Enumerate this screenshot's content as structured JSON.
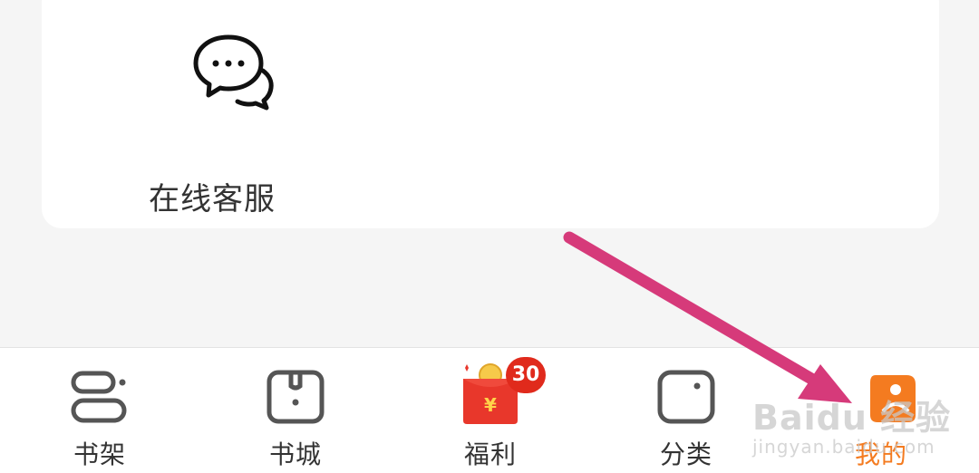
{
  "service_card": {
    "online_service_label": "在线客服"
  },
  "tabbar": {
    "tabs": [
      {
        "label": "书架"
      },
      {
        "label": "书城"
      },
      {
        "label": "福利",
        "badge": "30"
      },
      {
        "label": "分类"
      },
      {
        "label": "我的"
      }
    ],
    "active_color": "#f47b20"
  },
  "watermark": {
    "brand": "Baidu 经验",
    "url": "jingyan.baidu.com"
  },
  "colors": {
    "annotation_arrow": "#d63a7a",
    "badge": "#e02a1c",
    "envelope": "#e8372b"
  },
  "icons": [
    "chat-bubbles-icon",
    "bookshelf-icon",
    "bookstore-icon",
    "red-envelope-icon",
    "category-icon",
    "profile-icon"
  ]
}
